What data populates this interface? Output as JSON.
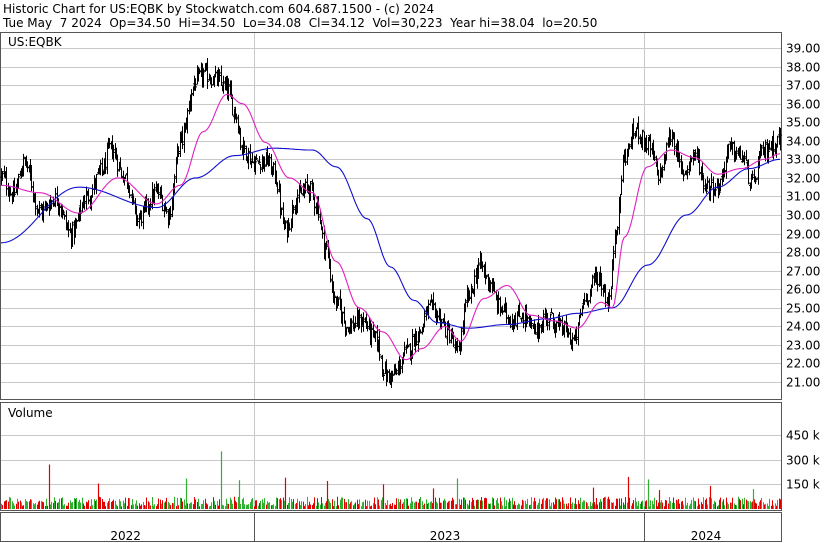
{
  "header": {
    "line1": "Historic Chart for US:EQBK by Stockwatch.com 604.687.1500 - (c) 2024",
    "line2": "Tue May  7 2024  Op=34.50  Hi=34.50  Lo=34.08  Cl=34.12  Vol=30,223  Year hi=38.04  lo=20.50"
  },
  "chart_data": [
    {
      "type": "ohlc",
      "symbol_label": "US:EQBK",
      "y_ticks": [
        "39.00",
        "38.00",
        "37.00",
        "36.00",
        "35.00",
        "34.00",
        "33.00",
        "32.00",
        "31.00",
        "30.00",
        "29.00",
        "28.00",
        "27.00",
        "26.00",
        "25.00",
        "24.00",
        "23.00",
        "22.00",
        "21.00"
      ],
      "ylim": [
        20.0,
        39.6
      ],
      "year_labels": [
        "2022",
        "2023",
        "2024"
      ],
      "colors": {
        "price_bars": "#000000",
        "ma_short": "#e020c0",
        "ma_long": "#1010d0",
        "grid": "#c8c8c8"
      },
      "price_anchors": [
        {
          "x": 0.0,
          "y": 32.1
        },
        {
          "x": 0.015,
          "y": 31.1
        },
        {
          "x": 0.03,
          "y": 32.8
        },
        {
          "x": 0.05,
          "y": 30.2
        },
        {
          "x": 0.07,
          "y": 30.9
        },
        {
          "x": 0.09,
          "y": 29.0
        },
        {
          "x": 0.11,
          "y": 31.0
        },
        {
          "x": 0.13,
          "y": 32.4
        },
        {
          "x": 0.14,
          "y": 33.6
        },
        {
          "x": 0.16,
          "y": 32.0
        },
        {
          "x": 0.175,
          "y": 29.8
        },
        {
          "x": 0.2,
          "y": 31.2
        },
        {
          "x": 0.215,
          "y": 30.1
        },
        {
          "x": 0.23,
          "y": 34.0
        },
        {
          "x": 0.25,
          "y": 37.2
        },
        {
          "x": 0.26,
          "y": 37.6
        },
        {
          "x": 0.275,
          "y": 37.3
        },
        {
          "x": 0.29,
          "y": 36.8
        },
        {
          "x": 0.3,
          "y": 35.6
        },
        {
          "x": 0.31,
          "y": 33.6
        },
        {
          "x": 0.325,
          "y": 32.8
        },
        {
          "x": 0.34,
          "y": 33.0
        },
        {
          "x": 0.35,
          "y": 32.3
        },
        {
          "x": 0.365,
          "y": 29.2
        },
        {
          "x": 0.38,
          "y": 31.0
        },
        {
          "x": 0.395,
          "y": 31.5
        },
        {
          "x": 0.405,
          "y": 30.6
        },
        {
          "x": 0.415,
          "y": 28.4
        },
        {
          "x": 0.43,
          "y": 25.2
        },
        {
          "x": 0.445,
          "y": 24.0
        },
        {
          "x": 0.465,
          "y": 24.3
        },
        {
          "x": 0.48,
          "y": 23.3
        },
        {
          "x": 0.495,
          "y": 21.3
        },
        {
          "x": 0.505,
          "y": 21.4
        },
        {
          "x": 0.52,
          "y": 22.6
        },
        {
          "x": 0.535,
          "y": 23.6
        },
        {
          "x": 0.55,
          "y": 25.0
        },
        {
          "x": 0.56,
          "y": 24.6
        },
        {
          "x": 0.575,
          "y": 23.6
        },
        {
          "x": 0.585,
          "y": 22.6
        },
        {
          "x": 0.6,
          "y": 25.6
        },
        {
          "x": 0.615,
          "y": 27.3
        },
        {
          "x": 0.625,
          "y": 26.5
        },
        {
          "x": 0.64,
          "y": 25.0
        },
        {
          "x": 0.655,
          "y": 24.4
        },
        {
          "x": 0.67,
          "y": 24.6
        },
        {
          "x": 0.685,
          "y": 23.7
        },
        {
          "x": 0.7,
          "y": 24.5
        },
        {
          "x": 0.72,
          "y": 23.9
        },
        {
          "x": 0.735,
          "y": 23.2
        },
        {
          "x": 0.75,
          "y": 25.6
        },
        {
          "x": 0.765,
          "y": 26.7
        },
        {
          "x": 0.78,
          "y": 25.4
        },
        {
          "x": 0.79,
          "y": 29.5
        },
        {
          "x": 0.8,
          "y": 33.2
        },
        {
          "x": 0.815,
          "y": 34.6
        },
        {
          "x": 0.83,
          "y": 33.8
        },
        {
          "x": 0.845,
          "y": 32.2
        },
        {
          "x": 0.86,
          "y": 34.3
        },
        {
          "x": 0.875,
          "y": 32.3
        },
        {
          "x": 0.89,
          "y": 33.3
        },
        {
          "x": 0.905,
          "y": 31.6
        },
        {
          "x": 0.92,
          "y": 31.5
        },
        {
          "x": 0.935,
          "y": 33.5
        },
        {
          "x": 0.95,
          "y": 33.2
        },
        {
          "x": 0.965,
          "y": 31.6
        },
        {
          "x": 0.975,
          "y": 33.2
        },
        {
          "x": 0.99,
          "y": 33.8
        },
        {
          "x": 1.0,
          "y": 34.1
        }
      ],
      "ma_short": [
        {
          "x": 0.0,
          "y": 31.6
        },
        {
          "x": 0.05,
          "y": 31.2
        },
        {
          "x": 0.1,
          "y": 30.1
        },
        {
          "x": 0.15,
          "y": 32.0
        },
        {
          "x": 0.2,
          "y": 30.6
        },
        {
          "x": 0.23,
          "y": 31.6
        },
        {
          "x": 0.26,
          "y": 34.5
        },
        {
          "x": 0.29,
          "y": 36.5
        },
        {
          "x": 0.31,
          "y": 36.0
        },
        {
          "x": 0.34,
          "y": 33.9
        },
        {
          "x": 0.37,
          "y": 32.0
        },
        {
          "x": 0.4,
          "y": 31.2
        },
        {
          "x": 0.43,
          "y": 27.5
        },
        {
          "x": 0.46,
          "y": 25.0
        },
        {
          "x": 0.49,
          "y": 23.7
        },
        {
          "x": 0.52,
          "y": 22.2
        },
        {
          "x": 0.54,
          "y": 22.8
        },
        {
          "x": 0.57,
          "y": 24.0
        },
        {
          "x": 0.59,
          "y": 23.2
        },
        {
          "x": 0.62,
          "y": 25.5
        },
        {
          "x": 0.65,
          "y": 26.2
        },
        {
          "x": 0.68,
          "y": 24.6
        },
        {
          "x": 0.71,
          "y": 24.3
        },
        {
          "x": 0.74,
          "y": 23.9
        },
        {
          "x": 0.77,
          "y": 25.3
        },
        {
          "x": 0.785,
          "y": 25.0
        },
        {
          "x": 0.8,
          "y": 28.8
        },
        {
          "x": 0.83,
          "y": 32.6
        },
        {
          "x": 0.86,
          "y": 33.5
        },
        {
          "x": 0.89,
          "y": 33.1
        },
        {
          "x": 0.92,
          "y": 32.2
        },
        {
          "x": 0.95,
          "y": 32.5
        },
        {
          "x": 0.98,
          "y": 33.0
        },
        {
          "x": 1.0,
          "y": 33.3
        }
      ],
      "ma_long": [
        {
          "x": 0.0,
          "y": 28.5
        },
        {
          "x": 0.1,
          "y": 31.5
        },
        {
          "x": 0.2,
          "y": 30.4
        },
        {
          "x": 0.25,
          "y": 32.0
        },
        {
          "x": 0.3,
          "y": 33.2
        },
        {
          "x": 0.35,
          "y": 33.6
        },
        {
          "x": 0.4,
          "y": 33.5
        },
        {
          "x": 0.43,
          "y": 32.6
        },
        {
          "x": 0.47,
          "y": 29.8
        },
        {
          "x": 0.5,
          "y": 27.2
        },
        {
          "x": 0.53,
          "y": 25.4
        },
        {
          "x": 0.56,
          "y": 24.2
        },
        {
          "x": 0.6,
          "y": 23.9
        },
        {
          "x": 0.65,
          "y": 24.1
        },
        {
          "x": 0.7,
          "y": 24.4
        },
        {
          "x": 0.74,
          "y": 24.7
        },
        {
          "x": 0.785,
          "y": 25.0
        },
        {
          "x": 0.83,
          "y": 27.3
        },
        {
          "x": 0.88,
          "y": 30.0
        },
        {
          "x": 0.92,
          "y": 31.5
        },
        {
          "x": 0.96,
          "y": 32.5
        },
        {
          "x": 1.0,
          "y": 33.0
        }
      ]
    },
    {
      "type": "bar",
      "title": "Volume",
      "y_ticks": [
        "450 k",
        "300 k",
        "150 k"
      ],
      "ylim": [
        0,
        560
      ],
      "colors": {
        "up": "#30b030",
        "down": "#e00000"
      },
      "baseline_k": 45,
      "spikes": [
        {
          "x": 0.062,
          "value": 270,
          "color": "down"
        },
        {
          "x": 0.125,
          "value": 155,
          "color": "down"
        },
        {
          "x": 0.237,
          "value": 185,
          "color": "up"
        },
        {
          "x": 0.282,
          "value": 350,
          "color": "up"
        },
        {
          "x": 0.305,
          "value": 175,
          "color": "up"
        },
        {
          "x": 0.365,
          "value": 190,
          "color": "down"
        },
        {
          "x": 0.418,
          "value": 170,
          "color": "down"
        },
        {
          "x": 0.49,
          "value": 150,
          "color": "down"
        },
        {
          "x": 0.555,
          "value": 125,
          "color": "down"
        },
        {
          "x": 0.585,
          "value": 185,
          "color": "up"
        },
        {
          "x": 0.76,
          "value": 130,
          "color": "down"
        },
        {
          "x": 0.805,
          "value": 195,
          "color": "down"
        },
        {
          "x": 0.83,
          "value": 180,
          "color": "up"
        },
        {
          "x": 0.845,
          "value": 115,
          "color": "down"
        },
        {
          "x": 0.91,
          "value": 140,
          "color": "down"
        },
        {
          "x": 0.965,
          "value": 120,
          "color": "up"
        }
      ]
    }
  ]
}
